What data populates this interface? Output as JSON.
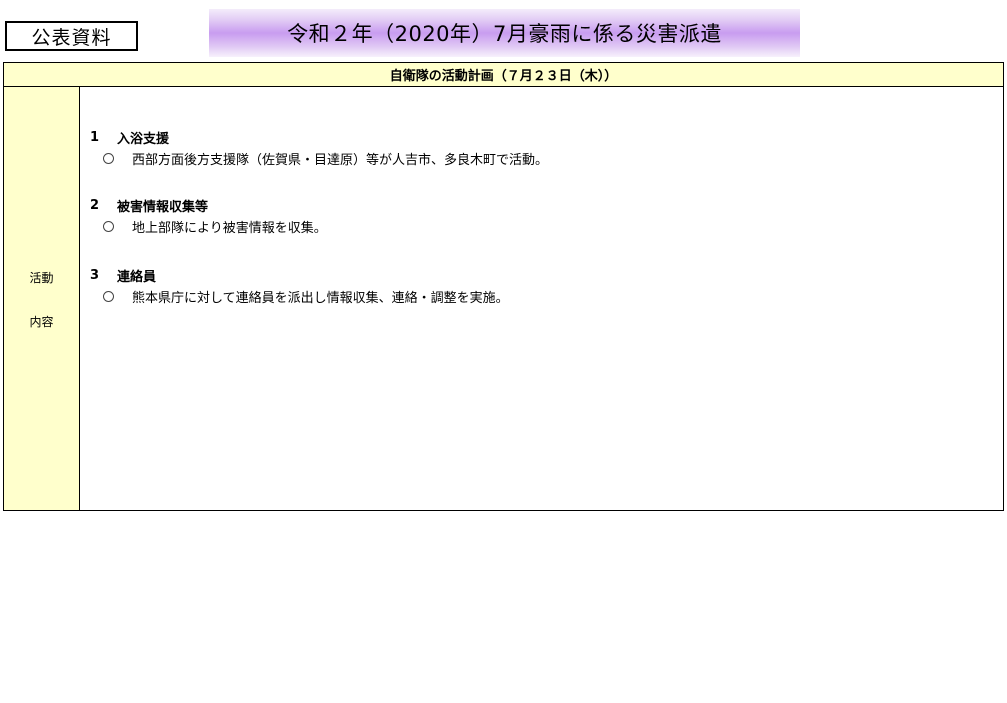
{
  "badge": {
    "label": "公表資料"
  },
  "banner": {
    "title": "令和２年（2020年）7月豪雨に係る災害派遣"
  },
  "table": {
    "header": "自衛隊の活動計画（７月２３日（木））",
    "row_label": {
      "line1": "活動",
      "line2": "内容"
    },
    "sections": [
      {
        "number": "1",
        "title": "入浴支援",
        "items": [
          "西部方面後方支援隊（佐賀県・目達原）等が人吉市、多良木町で活動。"
        ]
      },
      {
        "number": "2",
        "title": "被害情報収集等",
        "items": [
          "地上部隊により被害情報を収集。"
        ]
      },
      {
        "number": "3",
        "title": "連絡員",
        "items": [
          "熊本県庁に対して連絡員を派出し情報収集、連絡・調整を実施。"
        ]
      }
    ]
  },
  "colors": {
    "header_bg": "#ffffcc",
    "banner_purple": "#c89cf0",
    "border": "#000000"
  },
  "icons": {
    "bullet": "circle-icon"
  }
}
